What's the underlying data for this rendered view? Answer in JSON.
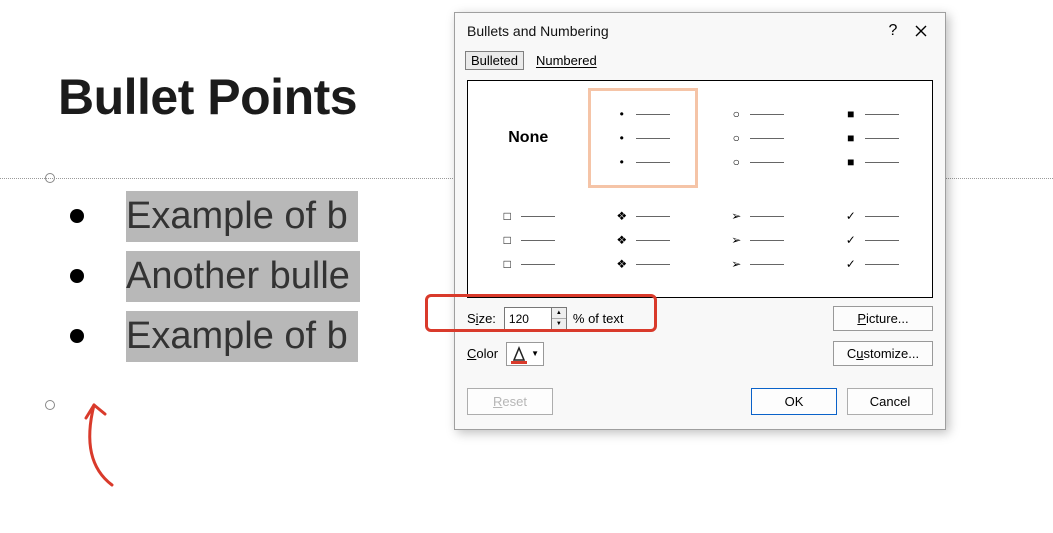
{
  "slide": {
    "title": "Bullet Points",
    "lines": [
      "Example of b",
      "Another bulle",
      "Example of b"
    ]
  },
  "dialog": {
    "title": "Bullets and Numbering",
    "tabs": {
      "bulleted": "Bulleted",
      "numbered": "Numbered",
      "active": "bulleted"
    },
    "gallery": {
      "none_label": "None",
      "selected_index": 1
    },
    "size": {
      "label_pre": "S",
      "label_u": "i",
      "label_post": "ze:",
      "value": "120",
      "suffix": "% of text"
    },
    "picture": {
      "label_pre": "",
      "label_u": "P",
      "label_post": "icture..."
    },
    "color": {
      "label_pre": "",
      "label_u": "C",
      "label_post": "olor"
    },
    "customize": {
      "label_pre": "C",
      "label_u": "u",
      "label_post": "stomize..."
    },
    "reset": {
      "label_pre": "",
      "label_u": "R",
      "label_post": "eset"
    },
    "ok": "OK",
    "cancel": "Cancel"
  }
}
